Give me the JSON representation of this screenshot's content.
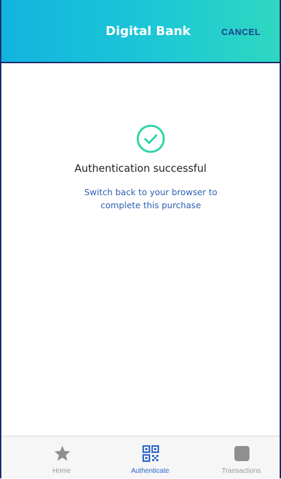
{
  "header": {
    "title": "Digital Bank",
    "cancel_label": "CANCEL"
  },
  "main": {
    "success_icon": "check-circle-icon",
    "title": "Authentication successful",
    "subtitle": "Switch back to your browser to complete this purchase"
  },
  "bottom_nav": {
    "items": [
      {
        "label": "Home",
        "icon": "star-icon",
        "active": false
      },
      {
        "label": "Authenticate",
        "icon": "qr-code-icon",
        "active": true
      },
      {
        "label": "Transactions",
        "icon": "rounded-square-icon",
        "active": false
      }
    ]
  },
  "colors": {
    "header_gradient_start": "#12b4de",
    "header_gradient_end": "#2ed8c0",
    "success_green": "#2fd5a6",
    "link_blue": "#2c5fb3",
    "active_nav": "#2a66c7",
    "inactive_icon": "#8f8f8f"
  }
}
